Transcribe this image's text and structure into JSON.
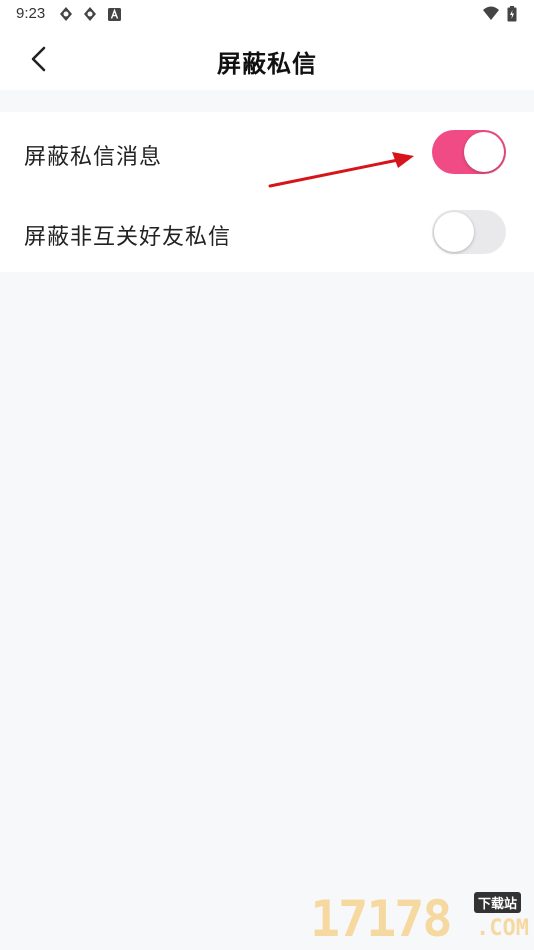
{
  "status_bar": {
    "time": "9:23",
    "icons_left": [
      "shield-icon",
      "shield-icon",
      "a-icon"
    ],
    "icons_right": [
      "wifi-icon",
      "battery-icon"
    ]
  },
  "nav": {
    "title": "屏蔽私信",
    "back_icon": "chevron-left-icon"
  },
  "settings": [
    {
      "label": "屏蔽私信消息",
      "enabled": true
    },
    {
      "label": "屏蔽非互关好友私信",
      "enabled": false
    }
  ],
  "colors": {
    "toggle_on": "#f04b84",
    "toggle_off": "#e9e9eb",
    "annotation_arrow": "#d8141b",
    "background": "#f7f8fa"
  },
  "watermark": {
    "number": "17178",
    "badge": "下载站",
    "suffix": ".COM"
  }
}
